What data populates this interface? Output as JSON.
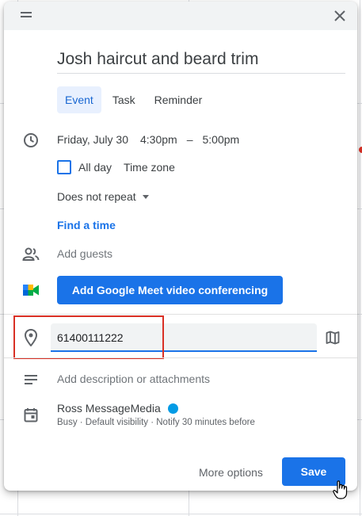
{
  "dialog": {
    "title": "Josh haircut and beard trim",
    "tabs": [
      {
        "label": "Event",
        "active": true
      },
      {
        "label": "Task",
        "active": false
      },
      {
        "label": "Reminder",
        "active": false
      }
    ],
    "date": "Friday, July 30",
    "start_time": "4:30pm",
    "dash": "–",
    "end_time": "5:00pm",
    "all_day_label": "All day",
    "all_day_checked": false,
    "timezone_label": "Time zone",
    "repeat_label": "Does not repeat",
    "find_time_label": "Find a time",
    "add_guests_placeholder": "Add guests",
    "meet_button_label": "Add Google Meet video conferencing",
    "location_value": "61400111222",
    "description_placeholder": "Add description or attachments",
    "calendar_name": "Ross MessageMedia",
    "calendar_details": "Busy · Default visibility · Notify 30 minutes before",
    "more_options_label": "More options",
    "save_label": "Save"
  },
  "colors": {
    "accent": "#1a73e8",
    "highlight": "#d93025",
    "calendar_dot": "#039be5"
  },
  "icons": [
    "drag-handle-icon",
    "close-icon",
    "clock-icon",
    "people-icon",
    "google-meet-icon",
    "location-pin-icon",
    "map-icon",
    "description-lines-icon",
    "calendar-icon",
    "hand-cursor-icon"
  ]
}
